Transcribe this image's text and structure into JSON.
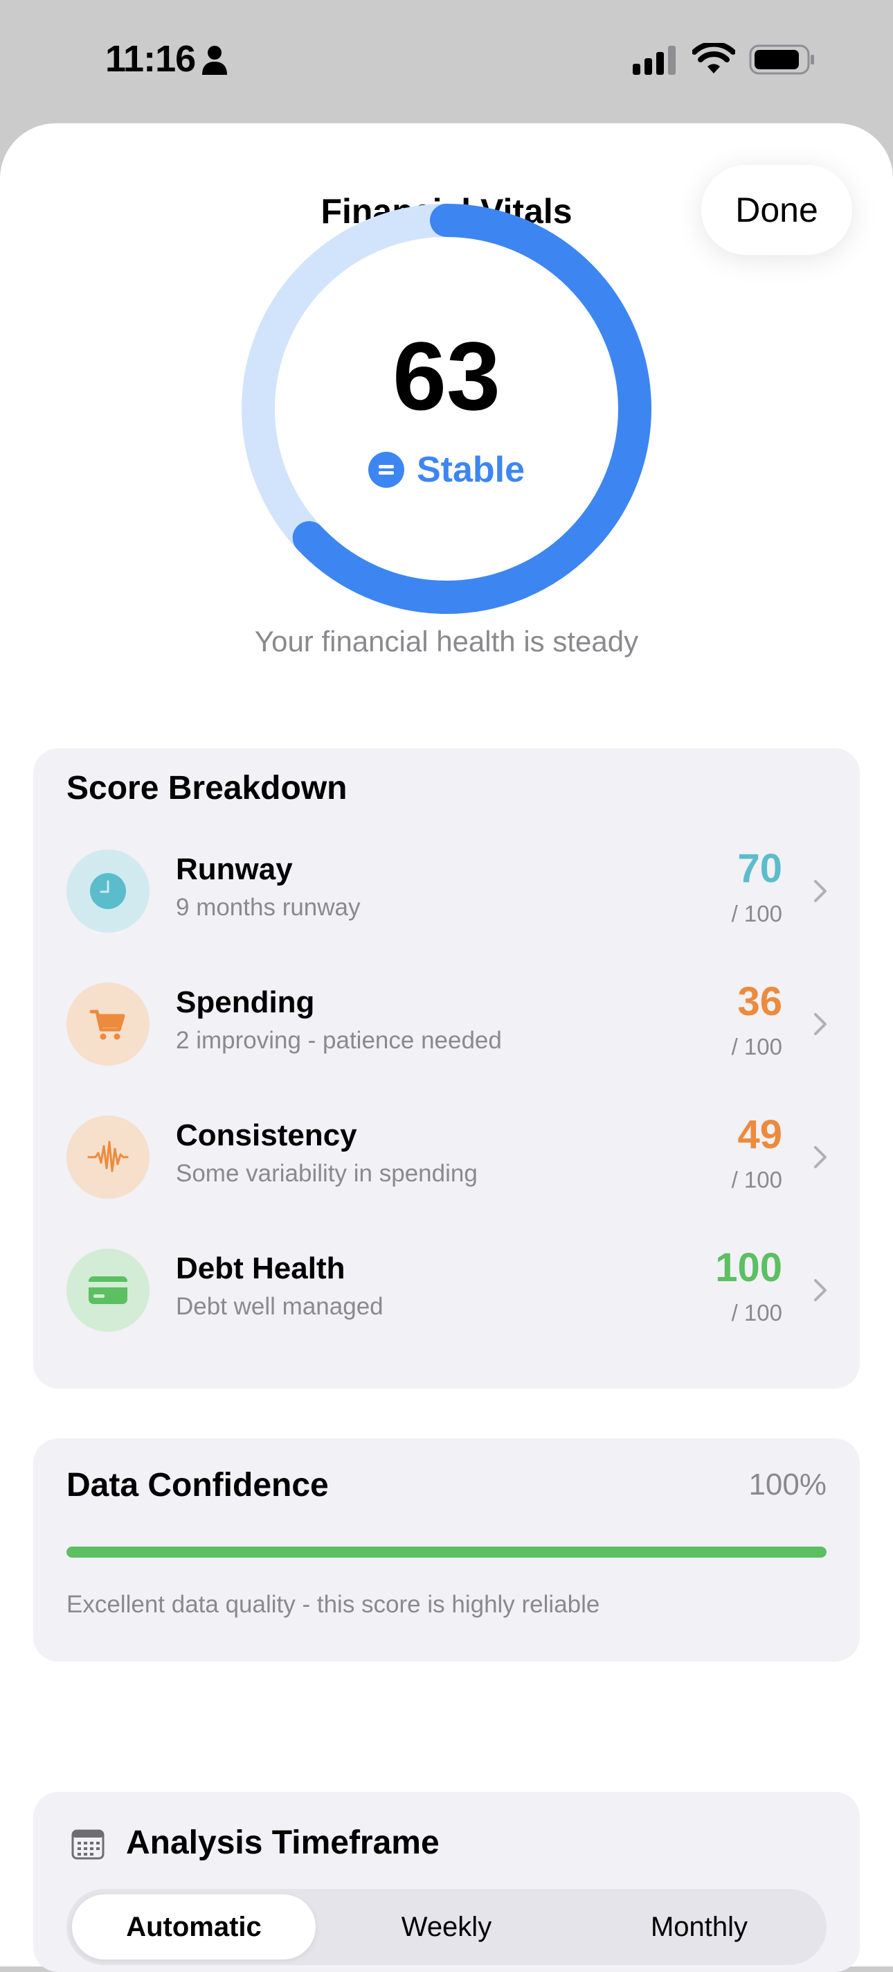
{
  "status_bar": {
    "time": "11:16"
  },
  "header": {
    "title": "Financial Vitals",
    "done_label": "Done"
  },
  "score": {
    "value": "63",
    "fraction": 0.63,
    "trend_label": "Stable",
    "message": "Your financial health is steady",
    "colors": {
      "ring": "#3d86f2",
      "track": "#d2e4fb"
    }
  },
  "breakdown": {
    "heading": "Score Breakdown",
    "items": [
      {
        "title": "Runway",
        "subtitle": "9 months runway",
        "score": "70",
        "max": "/ 100",
        "icon": "clock-icon",
        "color": "#5bbccc",
        "icon_bg": "#d0eaf0"
      },
      {
        "title": "Spending",
        "subtitle": "2 improving - patience needed",
        "score": "36",
        "max": "/ 100",
        "icon": "cart-icon",
        "color": "#ec8b3d",
        "icon_bg": "#f6dfcb"
      },
      {
        "title": "Consistency",
        "subtitle": "Some variability in spending",
        "score": "49",
        "max": "/ 100",
        "icon": "waveform-icon",
        "color": "#ec8b3d",
        "icon_bg": "#f6dfcb"
      },
      {
        "title": "Debt Health",
        "subtitle": "Debt well managed",
        "score": "100",
        "max": "/ 100",
        "icon": "credit-card-icon",
        "color": "#5cbf62",
        "icon_bg": "#d3ecd5"
      }
    ]
  },
  "confidence": {
    "heading": "Data Confidence",
    "percent": "100%",
    "fraction": 1.0,
    "note": "Excellent data quality - this score is highly reliable",
    "color": "#5cbf62"
  },
  "timeframe": {
    "heading": "Analysis Timeframe",
    "options": [
      "Automatic",
      "Weekly",
      "Monthly"
    ],
    "selected": "Automatic"
  }
}
